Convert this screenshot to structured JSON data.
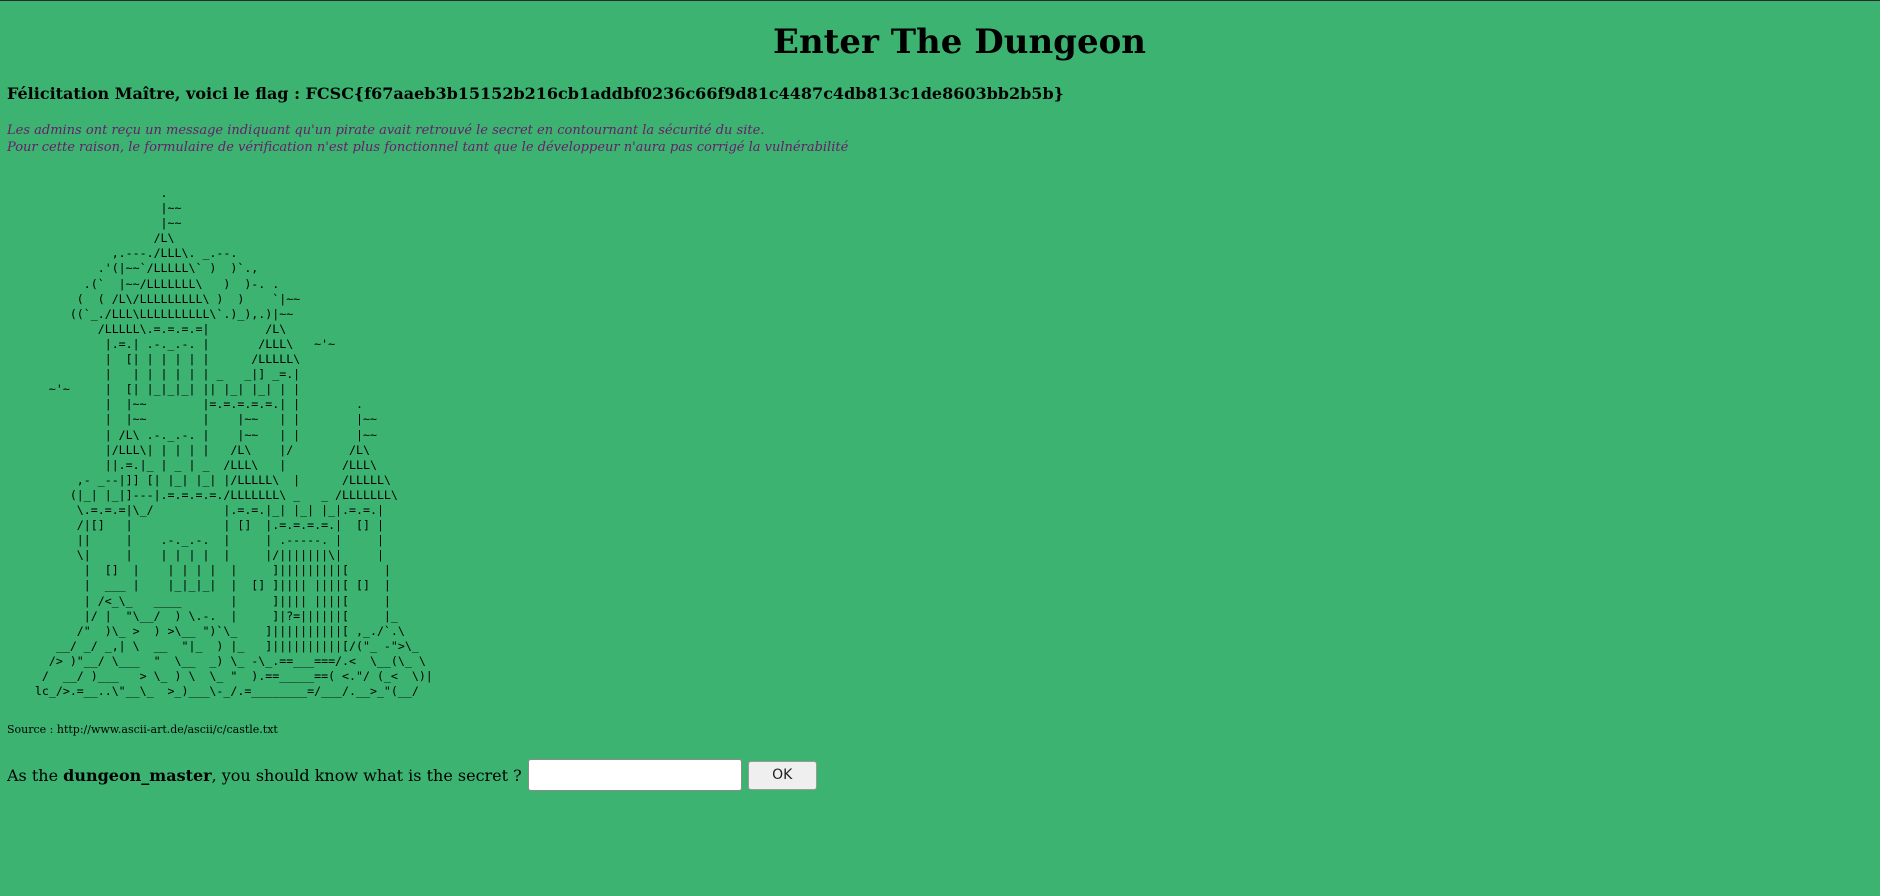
{
  "page": {
    "title": "Enter The Dungeon"
  },
  "flag_line": {
    "text": "Félicitation Maître, voici le flag : FCSC{f67aaeb3b15152b216cb1addbf0236c66f9d81c4487c4db813c1de8603bb2b5b}"
  },
  "notice": {
    "line1": "Les admins ont reçu un message indiquant qu'un pirate avait retrouvé le secret en contournant la sécurité du site.",
    "line2": "Pour cette raison, le formulaire de vérification n'est plus fonctionnel tant que le développeur n'aura pas corrigé la vulnérabilité"
  },
  "ascii_art": "                      .\n                      |~~\n                      |~~\n                     /L\\\n               ,.---./LLL\\. _.--.\n             .'(|~~`/LLLLL\\` )  )`.,\n           .(`  |~~/LLLLLLL\\   )  )-. .\n          (  ( /L\\/LLLLLLLLL\\ )  )    `|~~\n         ((`_./LLL\\LLLLLLLLLL\\`.)_),.)|~~\n             /LLLLL\\.=.=.=.=|        /L\\\n              |.=.| .-._.-. |       /LLL\\   ~'~\n              |  [| | | | | |      /LLLLL\\\n              |   | | | | | | _   _|] _=.|\n      ~'~     |  [| |_|_|_| || |_| |_| | |\n              |  |~~        |=.=.=.=.=.| |        .\n              |  |~~        |    |~~   | |        |~~\n              | /L\\ .-._.-. |    |~~   | |        |~~\n              |/LLL\\| | | | |   /L\\    |/        /L\\\n              ||.=.|_ | _ | _  /LLL\\   |        /LLL\\\n          ,- _--|]] [| |_| |_| |/LLLLL\\  |      /LLLLL\\\n         (|_| |_|]---|.=.=.=.=./LLLLLLL\\ _   _ /LLLLLLL\\\n          \\.=.=.=|\\_/          |.=.=.|_| |_| |_|.=.=.|\n          /|[]   |             | []  |.=.=.=.=.|  [] |\n          ||     |    .-._.-.  |     | .-----. |     |\n          \\|     |    | | | |  |     |/|||||||\\|     |\n           |  []  |    | | | |  |     ]|||||||||[     |\n           |  ___ |    |_|_|_|  |  [] ]|||| ||||[ []  |\n           | /<_\\_   ____       |     ]|||| ||||[     |\n           |/ |  \"\\__/  ) \\.-.  |     ]|?=||||||[     |_\n          /\"  )\\_ >  ) >\\__ \")`\\_    ]||||||||||[ ,_./`.\\\n       __/ _/ _,| \\  __  \"|_  ) |_   ]||||||||||[/(\"_ -\">\\_\n      /> )\"__/ \\___  \"  \\__  _) \\_ -\\_.==___===/.<  \\__(\\_ \\\n     /  __/ )___   > \\_ ) \\  \\_ \"  ).==_____==( <.\"/ (_<  \\)|\n    lc_/>.=__..\\\"__\\_  >_)___\\-_/.=________=/___/.__>_\"(__/",
  "source": {
    "text": "Source : http://www.ascii-art.de/ascii/c/castle.txt"
  },
  "form": {
    "prompt_before": "As the ",
    "prompt_bold": "dungeon_master",
    "prompt_after": ", you should know what is the secret ?",
    "input_value": "",
    "submit_label": "OK"
  }
}
